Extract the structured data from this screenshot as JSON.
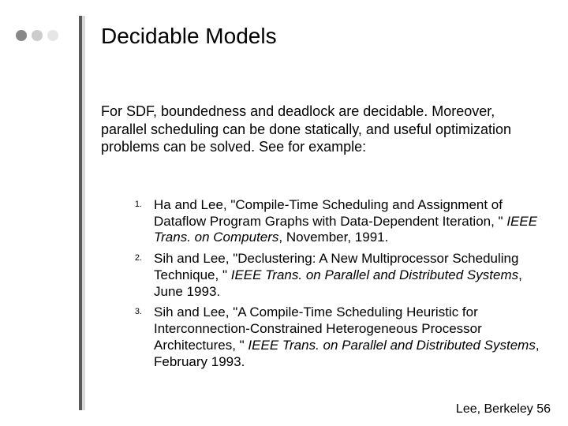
{
  "title": "Decidable Models",
  "intro": "For SDF, boundedness and deadlock are decidable. Moreover, parallel scheduling can be done statically, and useful optimization problems can be solved. See for example:",
  "refs": [
    {
      "num": "1.",
      "pre": "Ha and Lee, \"Compile-Time Scheduling and Assignment of Dataflow Program Graphs with Data-Dependent Iteration, \" ",
      "ital": "IEEE Trans. on Computers",
      "post": ", November, 1991."
    },
    {
      "num": "2.",
      "pre": "Sih and Lee, \"Declustering: A New Multiprocessor Scheduling Technique, \" ",
      "ital": "IEEE Trans. on Parallel and Distributed Systems",
      "post": ", June 1993."
    },
    {
      "num": "3.",
      "pre": "Sih and Lee, \"A Compile-Time Scheduling Heuristic for Interconnection-Constrained Heterogeneous Processor Architectures, \" ",
      "ital": "IEEE Trans. on Parallel and Distributed Systems",
      "post": ", February 1993."
    }
  ],
  "footer": "Lee, Berkeley 56"
}
